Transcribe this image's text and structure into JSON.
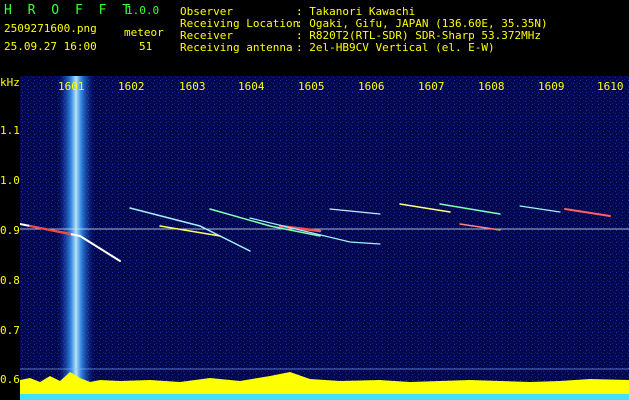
{
  "app": {
    "title": "H R O F F T",
    "version": "1.0.0",
    "filename": "2509271600.png",
    "datetime": "25.09.27 16:00",
    "meteor_label": "meteor",
    "meteor_count": "51"
  },
  "info": {
    "labels": [
      "Observer",
      "Receiving Location",
      "Receiver",
      "Receiving antenna"
    ],
    "values": [
      ": Takanori Kawachi",
      ": Ogaki, Gifu, JAPAN (136.60E, 35.35N)",
      ": R820T2(RTL-SDR) SDR-Sharp 53.372MHz",
      ": 2el-HB9CV Vertical (el. E-W)"
    ]
  },
  "axis": {
    "y_unit": "kHz",
    "y_ticks": [
      "1.1",
      "1.0",
      "0.9",
      "0.8",
      "0.7",
      "0.6"
    ],
    "x_ticks": [
      "1601",
      "1602",
      "1603",
      "1604",
      "1605",
      "1606",
      "1607",
      "1608",
      "1609",
      "1610"
    ]
  },
  "colors": {
    "background": "#00003a",
    "noise": "#0a1a8c",
    "signal_line": "#ffffff",
    "band": "#5fd0ff",
    "yellow_text": "#ffff00",
    "green_text": "#3cff3c",
    "bottom_spectrum": "#ffff00"
  }
}
